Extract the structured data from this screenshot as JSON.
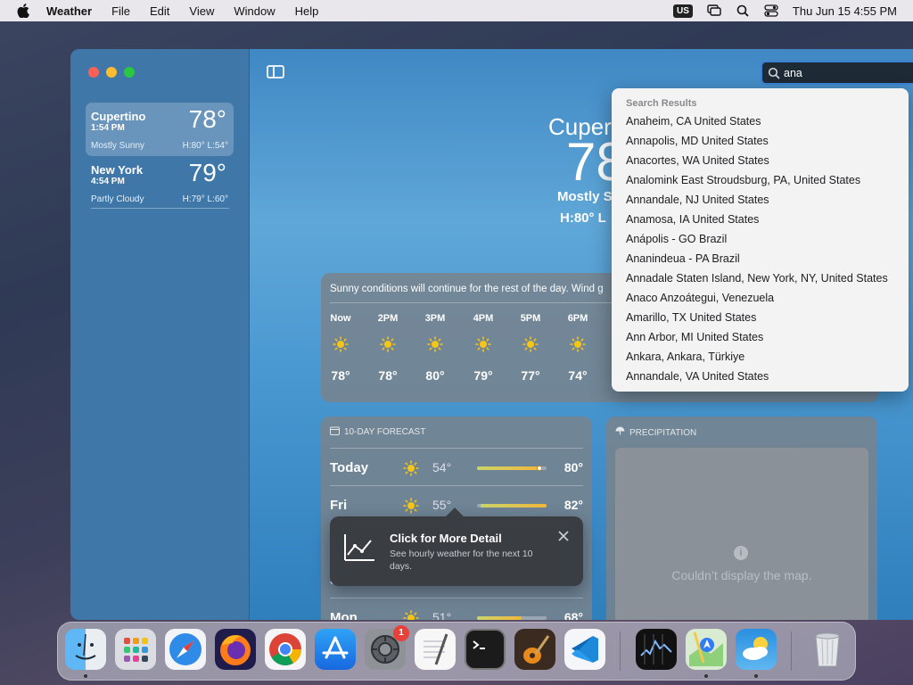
{
  "menubar": {
    "app": "Weather",
    "items": [
      "File",
      "Edit",
      "View",
      "Window",
      "Help"
    ],
    "input_source": "US",
    "datetime": "Thu Jun 15  4:55 PM"
  },
  "sidebar": {
    "cities": [
      {
        "name": "Cupertino",
        "time": "1:54 PM",
        "temp": "78°",
        "condition": "Mostly Sunny",
        "hilo": "H:80°  L:54°"
      },
      {
        "name": "New York",
        "time": "4:54 PM",
        "temp": "79°",
        "condition": "Partly Cloudy",
        "hilo": "H:79°  L:60°"
      }
    ]
  },
  "hero": {
    "city": "Cuper",
    "temp": "78",
    "condition": "Mostly S",
    "hilo": "H:80°  L"
  },
  "hourly": {
    "summary": "Sunny conditions will continue for the rest of the day. Wind g",
    "hours": [
      {
        "label": "Now",
        "temp": "78°"
      },
      {
        "label": "2PM",
        "temp": "78°"
      },
      {
        "label": "3PM",
        "temp": "80°"
      },
      {
        "label": "4PM",
        "temp": "79°"
      },
      {
        "label": "5PM",
        "temp": "77°"
      },
      {
        "label": "6PM",
        "temp": "74°"
      }
    ]
  },
  "forecast": {
    "header": "10-DAY FORECAST",
    "days": [
      {
        "day": "Today",
        "lo": "54°",
        "hi": "80°",
        "range": {
          "from": 0.0,
          "to": 0.9
        },
        "current": 0.88
      },
      {
        "day": "Fri",
        "lo": "55°",
        "hi": "82°",
        "range": {
          "from": 0.05,
          "to": 1.0
        }
      },
      {
        "day": "Sat",
        "lo": "",
        "hi": ""
      },
      {
        "day": "Mon",
        "lo": "51°",
        "hi": "68°"
      }
    ]
  },
  "tooltip": {
    "title": "Click for More Detail",
    "body": "See hourly weather for the next 10 days."
  },
  "precipitation": {
    "header": "PRECIPITATION",
    "message": "Couldn’t display the map."
  },
  "search": {
    "value": "ana",
    "results_header": "Search Results",
    "results": [
      "Anaheim, CA United States",
      "Annapolis, MD United States",
      "Anacortes, WA United States",
      "Analomink East Stroudsburg, PA, United States",
      "Annandale, NJ United States",
      "Anamosa, IA United States",
      "Anápolis - GO Brazil",
      "Ananindeua - PA Brazil",
      "Annadale Staten Island, New York, NY, United States",
      "Anaco Anzoátegui, Venezuela",
      "Amarillo, TX United States",
      "Ann Arbor, MI United States",
      "Ankara, Ankara, Türkiye",
      "Annandale, VA United States"
    ]
  },
  "dock": {
    "apps": [
      "finder-icon",
      "launchpad-icon",
      "safari-icon",
      "firefox-icon",
      "chrome-icon",
      "app-store-icon",
      "system-settings-icon",
      "textedit-icon",
      "terminal-icon",
      "garageband-icon",
      "vscode-icon",
      "stocks-icon",
      "maps-icon",
      "weather-icon",
      "trash-icon"
    ],
    "settings_badge": "1"
  },
  "colors": {
    "accent": "#3a83d6",
    "sun": "#f5c518"
  }
}
